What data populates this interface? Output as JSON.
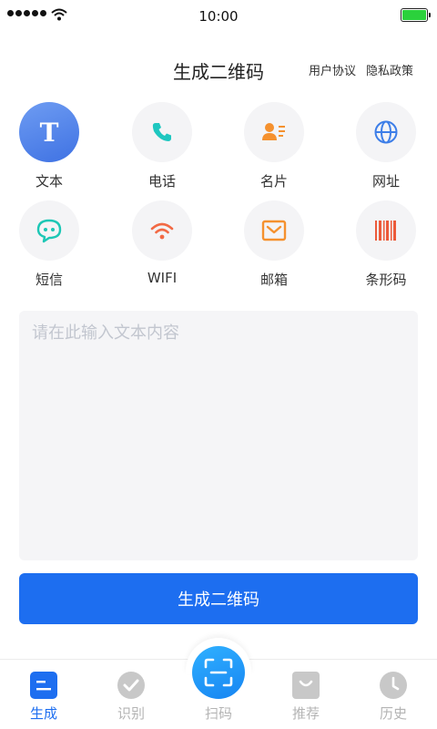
{
  "status_bar": {
    "time": "10:00"
  },
  "header": {
    "title": "生成二维码",
    "user_agreement": "用户协议",
    "privacy_policy": "隐私政策"
  },
  "types": [
    {
      "label": "文本",
      "icon": "text-icon",
      "color": "#ffffff",
      "selected": true
    },
    {
      "label": "电话",
      "icon": "phone-icon",
      "color": "#1fc7c0"
    },
    {
      "label": "名片",
      "icon": "contact-card-icon",
      "color": "#f5912e"
    },
    {
      "label": "网址",
      "icon": "globe-icon",
      "color": "#3d7ee8"
    },
    {
      "label": "短信",
      "icon": "message-icon",
      "color": "#1cc7b5"
    },
    {
      "label": "WIFI",
      "icon": "wifi-icon",
      "color": "#f26944"
    },
    {
      "label": "邮箱",
      "icon": "mail-icon",
      "color": "#f5912e"
    },
    {
      "label": "条形码",
      "icon": "barcode-icon",
      "color": "#ec5a3a"
    }
  ],
  "input": {
    "placeholder": "请在此输入文本内容",
    "value": ""
  },
  "generate_button": {
    "label": "生成二维码"
  },
  "tab_bar": {
    "tabs": [
      {
        "label": "生成",
        "icon": "generate-icon",
        "active": true
      },
      {
        "label": "识别",
        "icon": "check-icon"
      },
      {
        "label": "扫码",
        "icon": "scan-icon"
      },
      {
        "label": "推荐",
        "icon": "bag-icon"
      },
      {
        "label": "历史",
        "icon": "clock-icon"
      }
    ]
  },
  "colors": {
    "accent": "#1d6ef0",
    "inactive_tab": "#b4b4b4",
    "battery": "#2bd13c"
  }
}
